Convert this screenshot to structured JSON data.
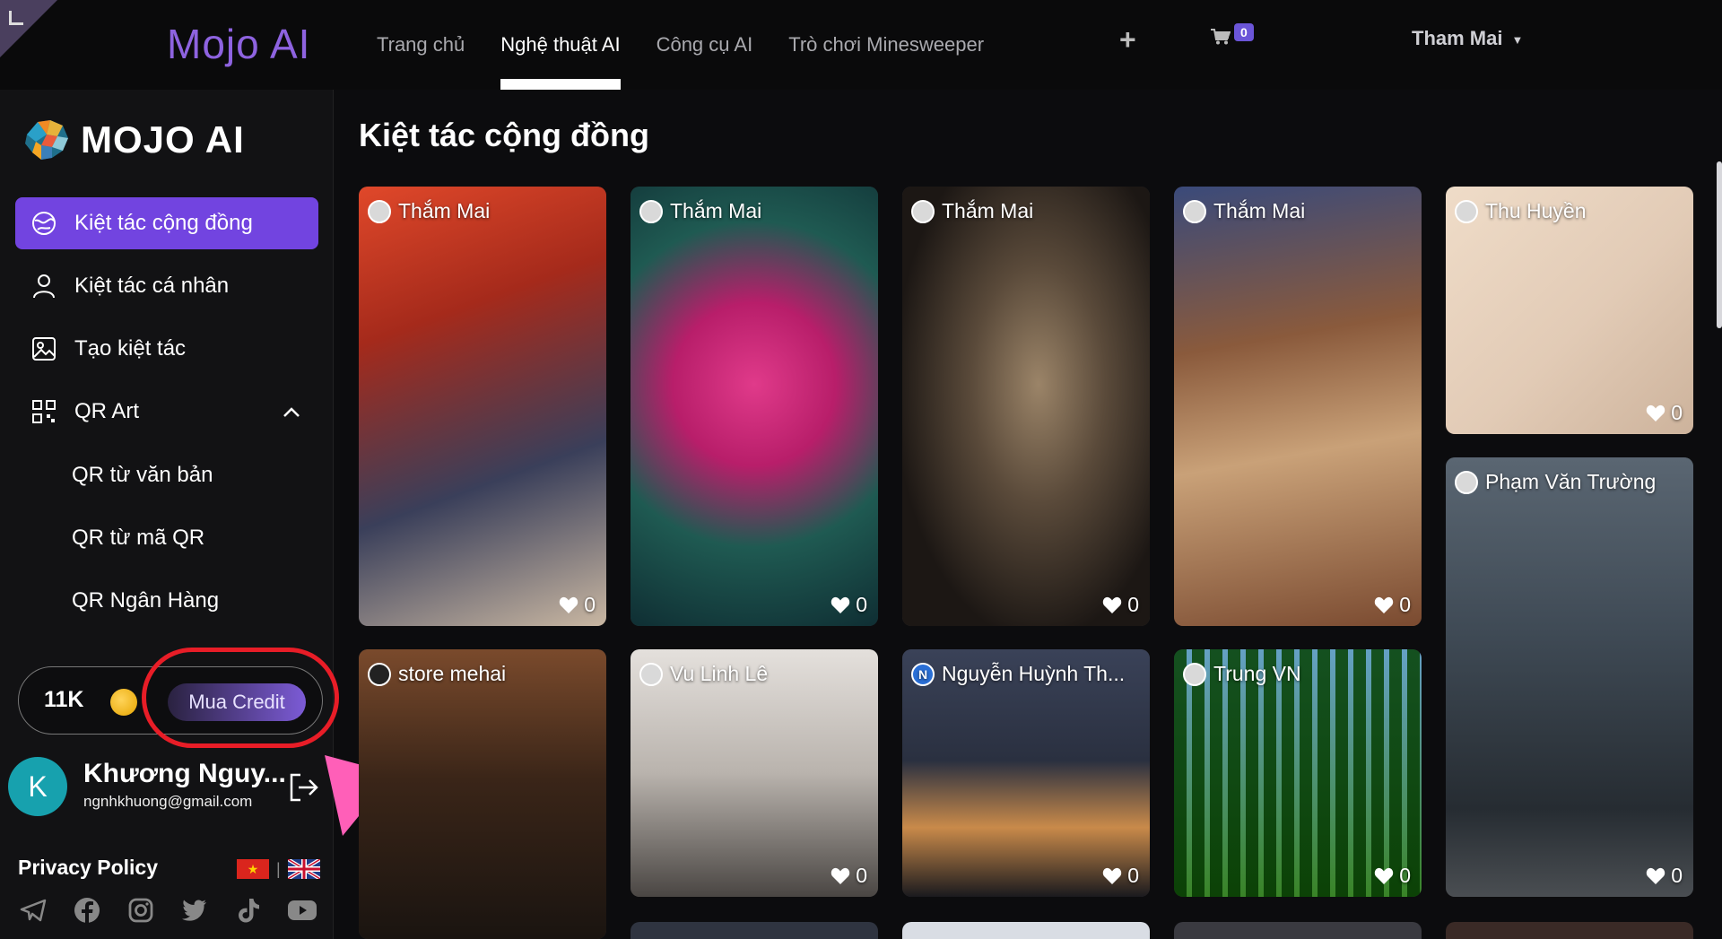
{
  "topbar": {
    "brand": "Mojo AI",
    "nav": [
      "Trang chủ",
      "Nghệ thuật AI",
      "Công cụ AI",
      "Trò chơi Minesweeper"
    ],
    "active_nav": 1,
    "cart_count": "0",
    "user_name": "Tham Mai"
  },
  "sidebar": {
    "logo_text": "MOJO AI",
    "menu": [
      {
        "label": "Kiệt tác cộng đồng",
        "icon": "community-icon",
        "active": true
      },
      {
        "label": "Kiệt tác cá nhân",
        "icon": "user-icon"
      },
      {
        "label": "Tạo kiệt tác",
        "icon": "image-icon"
      },
      {
        "label": "QR Art",
        "icon": "qr-icon",
        "expanded": true
      }
    ],
    "submenu": [
      "QR từ văn bản",
      "QR từ mã QR",
      "QR Ngân Hàng"
    ],
    "credits": "11K",
    "buy_label": "Mua Credit",
    "account": {
      "initial": "K",
      "name": "Khương Nguy...",
      "email": "ngnhkhuong@gmail.com"
    },
    "privacy": "Privacy Policy",
    "socials": [
      "telegram-icon",
      "facebook-icon",
      "instagram-icon",
      "twitter-icon",
      "tiktok-icon",
      "youtube-icon"
    ]
  },
  "main": {
    "title": "Kiệt tác cộng đồng",
    "cards": [
      {
        "author": "Thắm Mai",
        "likes": "0",
        "palette": "#c8402a"
      },
      {
        "author": "Thắm Mai",
        "likes": "0",
        "palette": "#d02f7a"
      },
      {
        "author": "Thắm Mai",
        "likes": "0",
        "palette": "#3a302a"
      },
      {
        "author": "Thắm Mai",
        "likes": "0",
        "palette": "#8a5a3c"
      },
      {
        "author": "Thu Huyền",
        "likes": "0",
        "palette": "#e2cbb6"
      },
      {
        "author": "Phạm Văn Trường",
        "likes": "0",
        "palette": "#3f4a55"
      },
      {
        "author": "store mehai",
        "likes": "",
        "palette": "#4a3424"
      },
      {
        "author": "Vu Linh Lê",
        "likes": "0",
        "palette": "#cfcac4"
      },
      {
        "author": "Nguyễn Huỳnh Th...",
        "likes": "0",
        "palette": "#2b3345"
      },
      {
        "author": "Trung VN",
        "likes": "0",
        "palette": "#3f8a2c"
      }
    ]
  },
  "colors": {
    "accent": "#7244e0",
    "brand": "#8e63e0",
    "annotation_ring": "#e81d27",
    "annotation_arrow": "#ff5fb8"
  }
}
